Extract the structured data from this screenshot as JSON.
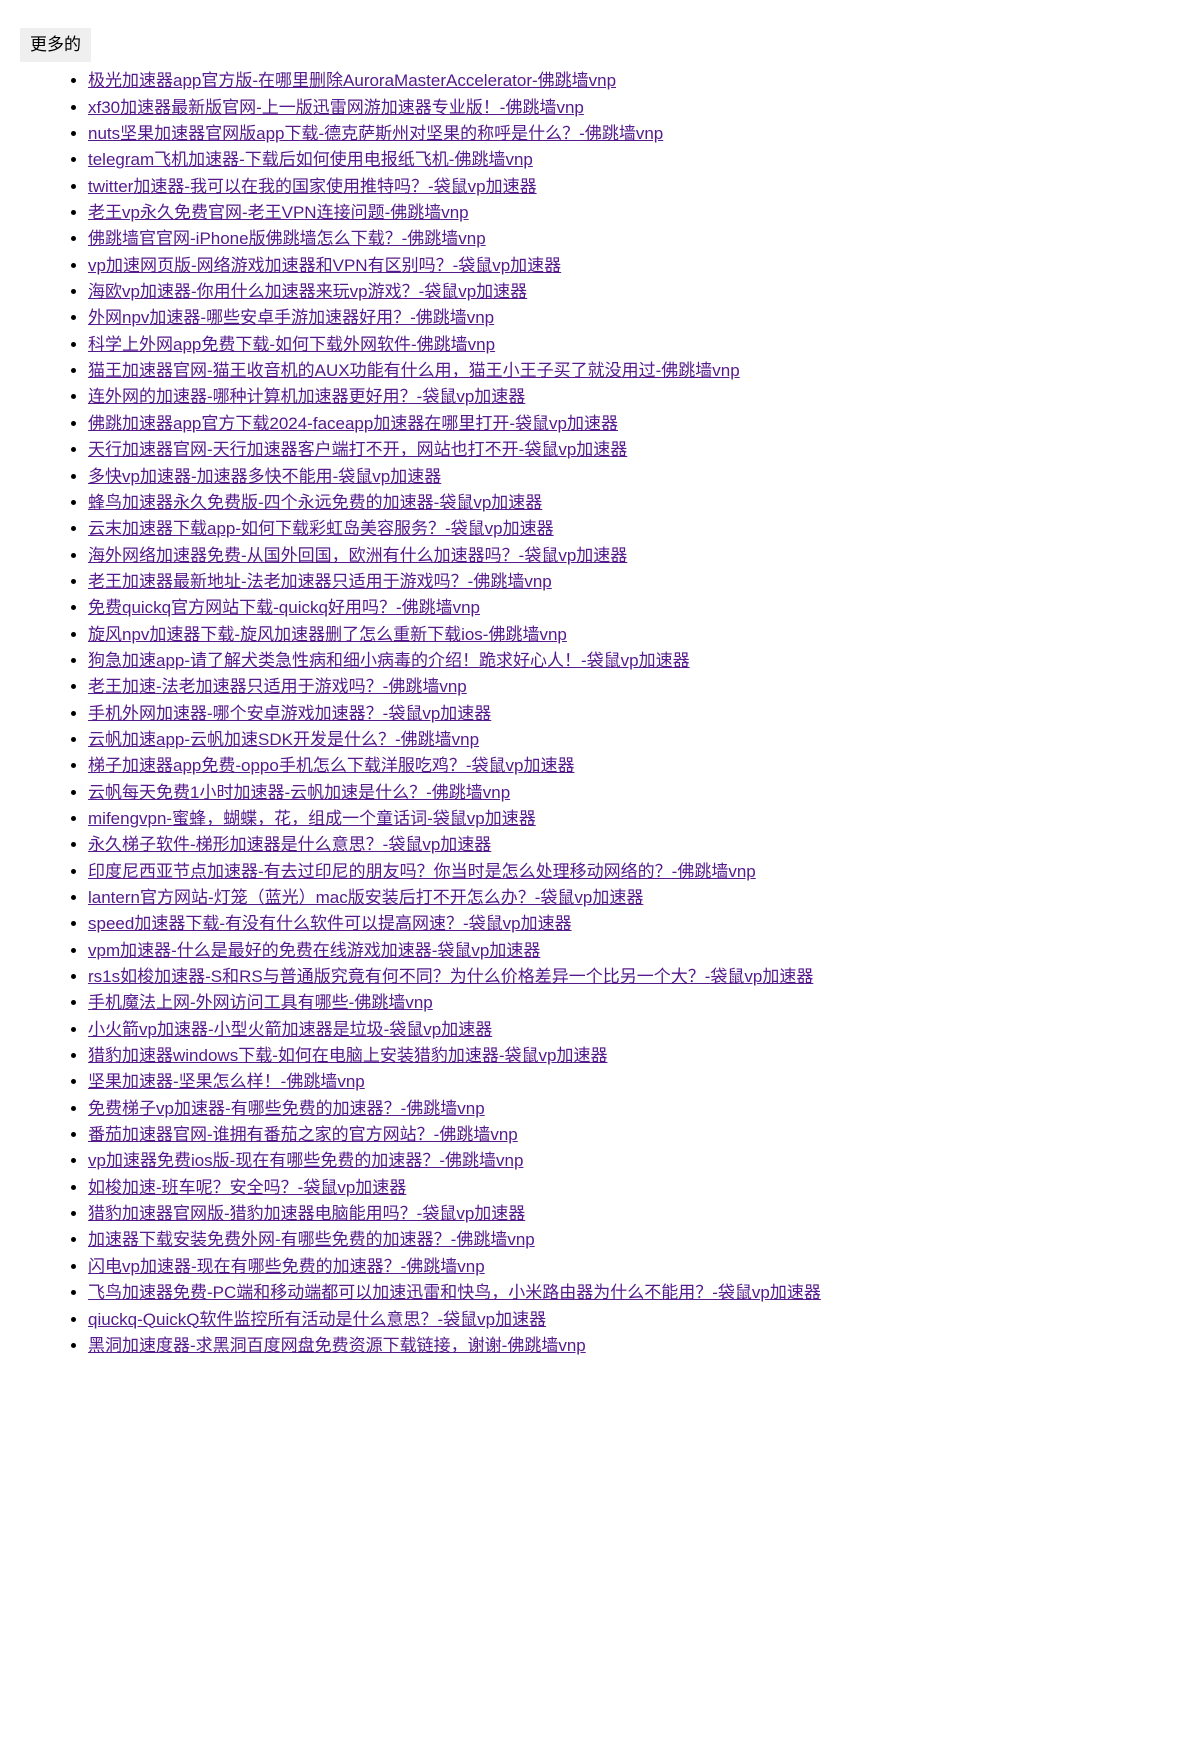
{
  "more_label": "更多的",
  "links": [
    "极光加速器app官方版-在哪里删除AuroraMasterAccelerator-佛跳墙vnp",
    "xf30加速器最新版官网-上一版迅雷网游加速器专业版！-佛跳墙vnp",
    "nuts坚果加速器官网版app下载-德克萨斯州对坚果的称呼是什么？-佛跳墙vnp",
    "telegram飞机加速器-下载后如何使用电报纸飞机-佛跳墙vnp",
    "twitter加速器-我可以在我的国家使用推特吗？-袋鼠vp加速器",
    "老王vp永久免费官网-老王VPN连接问题-佛跳墙vnp",
    "佛跳墙官官网-iPhone版佛跳墙怎么下载？-佛跳墙vnp",
    "vp加速网页版-网络游戏加速器和VPN有区别吗？-袋鼠vp加速器",
    "海欧vp加速器-你用什么加速器来玩vp游戏？-袋鼠vp加速器",
    "外网npv加速器-哪些安卓手游加速器好用？-佛跳墙vnp",
    "科学上外网app免费下载-如何下载外网软件-佛跳墙vnp",
    "猫王加速器官网-猫王收音机的AUX功能有什么用，猫王小王子买了就没用过-佛跳墙vnp",
    "连外网的加速器-哪种计算机加速器更好用？-袋鼠vp加速器",
    "佛跳加速器app官方下载2024-faceapp加速器在哪里打开-袋鼠vp加速器",
    "天行加速器官网-天行加速器客户端打不开，网站也打不开-袋鼠vp加速器",
    "多快vp加速器-加速器多快不能用-袋鼠vp加速器",
    "蜂鸟加速器永久免费版-四个永远免费的加速器-袋鼠vp加速器",
    "云末加速器下载app-如何下载彩虹岛美容服务？-袋鼠vp加速器",
    "海外网络加速器免费-从国外回国，欧洲有什么加速器吗？-袋鼠vp加速器",
    "老王加速器最新地址-法老加速器只适用于游戏吗？-佛跳墙vnp",
    "免费quickq官方网站下载-quickq好用吗？-佛跳墙vnp",
    "旋风npv加速器下载-旋风加速器删了怎么重新下载ios-佛跳墙vnp",
    "狗急加速app-请了解犬类急性病和细小病毒的介绍！跪求好心人！-袋鼠vp加速器",
    "老王加速-法老加速器只适用于游戏吗？-佛跳墙vnp",
    "手机外网加速器-哪个安卓游戏加速器？-袋鼠vp加速器",
    "云帆加速app-云帆加速SDK开发是什么？-佛跳墙vnp",
    "梯子加速器app免费-oppo手机怎么下载洋服吃鸡？-袋鼠vp加速器",
    "云帆每天免费1小时加速器-云帆加速是什么？-佛跳墙vnp",
    "mifengvpn-蜜蜂，蝴蝶，花，组成一个童话词-袋鼠vp加速器",
    "永久梯子软件-梯形加速器是什么意思？-袋鼠vp加速器",
    "印度尼西亚节点加速器-有去过印尼的朋友吗？你当时是怎么处理移动网络的？-佛跳墙vnp",
    "lantern官方网站-灯笼（蓝光）mac版安装后打不开怎么办？-袋鼠vp加速器",
    "speed加速器下载-有没有什么软件可以提高网速？-袋鼠vp加速器",
    "vpm加速器-什么是最好的免费在线游戏加速器-袋鼠vp加速器",
    "rs1s如梭加速器-S和RS与普通版究竟有何不同？为什么价格差异一个比另一个大？-袋鼠vp加速器",
    "手机魔法上网-外网访问工具有哪些-佛跳墙vnp",
    "小火箭vp加速器-小型火箭加速器是垃圾-袋鼠vp加速器",
    "猎豹加速器windows下载-如何在电脑上安装猎豹加速器-袋鼠vp加速器",
    "坚果加速器-坚果怎么样！-佛跳墙vnp",
    "免费梯子vp加速器-有哪些免费的加速器？-佛跳墙vnp",
    "番茄加速器官网-谁拥有番茄之家的官方网站？-佛跳墙vnp",
    "vp加速器免费ios版-现在有哪些免费的加速器？-佛跳墙vnp",
    "如梭加速-班车呢？安全吗？-袋鼠vp加速器",
    "猎豹加速器官网版-猎豹加速器电脑能用吗？-袋鼠vp加速器",
    "加速器下载安装免费外网-有哪些免费的加速器？-佛跳墙vnp",
    "闪电vp加速器-现在有哪些免费的加速器？-佛跳墙vnp",
    "飞鸟加速器免费-PC端和移动端都可以加速迅雷和快鸟，小米路由器为什么不能用？-袋鼠vp加速器",
    "qiuckq-QuickQ软件监控所有活动是什么意思？-袋鼠vp加速器",
    "黑洞加速度器-求黑洞百度网盘免费资源下载链接，谢谢-佛跳墙vnp"
  ]
}
